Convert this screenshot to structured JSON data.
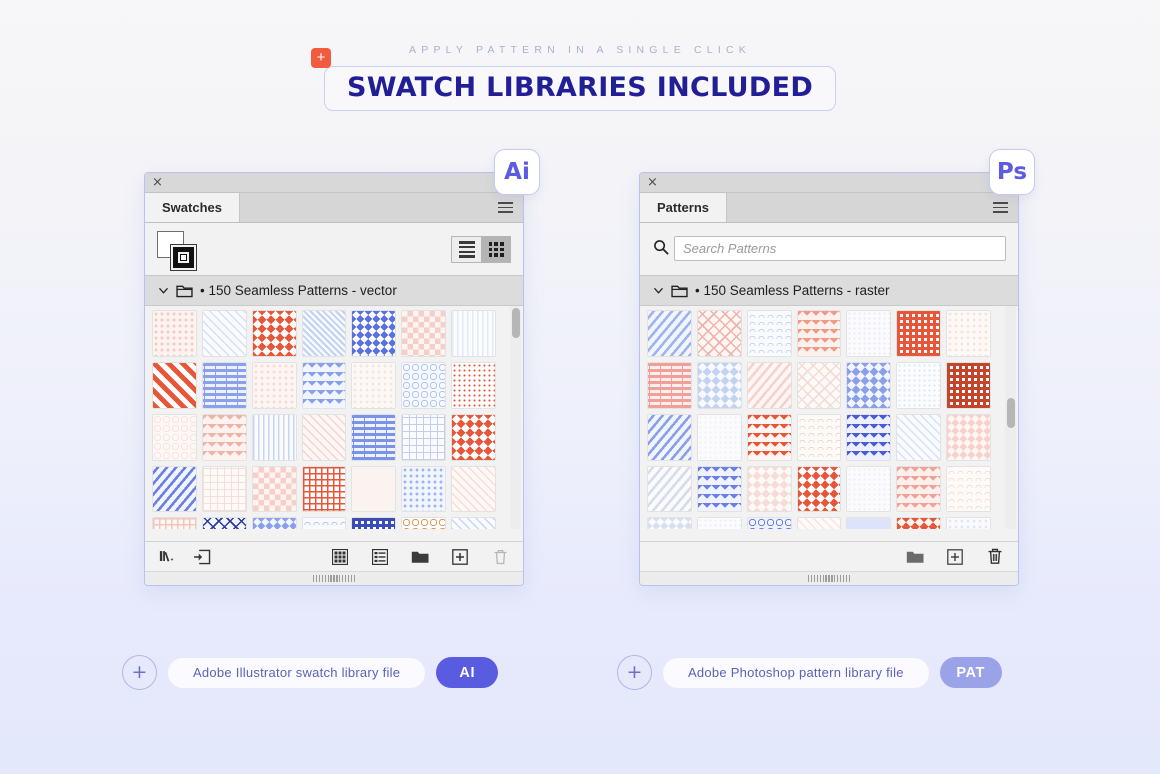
{
  "header": {
    "kicker": "APPLY PATTERN IN A SINGLE CLICK",
    "title": "SWATCH LIBRARIES INCLUDED",
    "plus_icon": "plus-icon",
    "accent_orange": "#F35B3F",
    "title_color": "#221E96"
  },
  "theme": {
    "bg_top": "#F7F7F9",
    "bg_bottom": "#E4E8FB",
    "purple": "#5A5CE0",
    "purple_light": "#9AA2E8",
    "panel_border": "#B9C2EE",
    "pattern_red": "#E8563A",
    "pattern_blue": "#5A6FE0",
    "pattern_pink": "#F3C9C2",
    "pattern_lightblue": "#B9C8F2"
  },
  "panels": [
    {
      "id": "illustrator",
      "app": "Ai",
      "close_label": "×",
      "tab_label": "Swatches",
      "menu_icon": "hamburger-menu-icon",
      "fill_stroke": {
        "fill_name": "fill-swatch",
        "stroke_name": "stroke-swatch"
      },
      "view_toggle": {
        "list_label": "list-view-icon",
        "grid_label": "grid-view-icon",
        "active": "grid"
      },
      "folder": {
        "chevron": "chevron-down-icon",
        "folder_icon": "folder-icon",
        "label": "• 150 Seamless Patterns - vector"
      },
      "footer_icons": [
        "swatch-libraries-menu-icon",
        "add-to-library-icon",
        "show-swatch-kinds-icon",
        "swatch-options-icon",
        "new-color-group-icon",
        "new-swatch-icon",
        "delete-swatch-icon"
      ]
    },
    {
      "id": "photoshop",
      "app": "Ps",
      "close_label": "×",
      "tab_label": "Patterns",
      "menu_icon": "hamburger-menu-icon",
      "search": {
        "icon": "search-icon",
        "placeholder": "Search Patterns",
        "value": ""
      },
      "folder": {
        "chevron": "chevron-down-icon",
        "folder_icon": "folder-icon",
        "label": "• 150 Seamless Patterns - raster"
      },
      "footer_icons": [
        "new-group-icon",
        "new-pattern-icon",
        "delete-pattern-icon"
      ]
    }
  ],
  "files": [
    {
      "id": "ai-file",
      "plus_icon": "plus-circle-icon",
      "label": "Adobe Illustrator swatch library file",
      "ext": "AI"
    },
    {
      "id": "ps-file",
      "plus_icon": "plus-circle-icon",
      "label": "Adobe Photoshop pattern library file",
      "ext": "PAT"
    }
  ],
  "swatch_grid": {
    "columns": 7,
    "illustrator_patterns": [
      {
        "t": "dotgrid",
        "c": "#F6C9C0",
        "bg": "#FDF3F0"
      },
      {
        "t": "diagline",
        "c": "#D9DFF4",
        "bg": "#FAFBFE"
      },
      {
        "t": "diamond",
        "c": "#E8563A",
        "bg": "#FFFFFF"
      },
      {
        "t": "diaghatch",
        "c": "#C3D2F2",
        "bg": "#F6F9FE"
      },
      {
        "t": "zigzag",
        "c": "#5A6FE0",
        "bg": "#FFFFFF"
      },
      {
        "t": "checker",
        "c": "#F3CFC8",
        "bg": "#FDF4F2"
      },
      {
        "t": "vline",
        "c": "#E3E9F8",
        "bg": "#FBFCFE"
      },
      {
        "t": "stripe",
        "c": "#E8563A",
        "bg": "#FFFFFF"
      },
      {
        "t": "brick",
        "c": "#8AA0EA",
        "bg": "#EDF1FD"
      },
      {
        "t": "dotgrid",
        "c": "#F7DAD3",
        "bg": "#FDF5F3"
      },
      {
        "t": "triangle",
        "c": "#8AA0EA",
        "bg": "#F1F5FE"
      },
      {
        "t": "dotgrid",
        "c": "#F3E6E0",
        "bg": "#FCF8F6"
      },
      {
        "t": "circles",
        "c": "#B4C6F0",
        "bg": "#F5F8FE"
      },
      {
        "t": "dotsm",
        "c": "#E8563A",
        "bg": "#FFFFFF"
      },
      {
        "t": "circles",
        "c": "#F7E4DE",
        "bg": "#FDF8F6"
      },
      {
        "t": "triangle",
        "c": "#F0B3AA",
        "bg": "#FDF2F0"
      },
      {
        "t": "vline",
        "c": "#C8D4F2",
        "bg": "#FAFBFE"
      },
      {
        "t": "diagline",
        "c": "#F6D4CD",
        "bg": "#FDF6F4"
      },
      {
        "t": "brick",
        "c": "#7A92E8",
        "bg": "#EEF2FD"
      },
      {
        "t": "grid",
        "c": "#C3CEEE",
        "bg": "#FAFBFE"
      },
      {
        "t": "diamond",
        "c": "#E8563A",
        "bg": "#FFFFFF"
      },
      {
        "t": "diagwave",
        "c": "#6B80E4",
        "bg": "#F2F5FE"
      },
      {
        "t": "grid",
        "c": "#F3DED8",
        "bg": "#FDF9F7"
      },
      {
        "t": "checker",
        "c": "#F5CFC8",
        "bg": "#FDF4F2"
      },
      {
        "t": "plus",
        "c": "#E8563A",
        "bg": "#FFFFFF"
      },
      {
        "t": "plain",
        "c": "#FBF3F0",
        "bg": "#FBF3F0"
      },
      {
        "t": "dotgrid",
        "c": "#9FB4EE",
        "bg": "#F1F5FE"
      },
      {
        "t": "diagline",
        "c": "#F6DCD5",
        "bg": "#FDF8F6"
      },
      {
        "t": "plus",
        "c": "#F0C6BD",
        "bg": "#FDF6F4"
      },
      {
        "t": "crosshatch",
        "c": "#2B3A9E",
        "bg": "#F4F6FD"
      },
      {
        "t": "zigzag",
        "c": "#8AA0EA",
        "bg": "#F3F6FE"
      },
      {
        "t": "wave",
        "c": "#B8C7F0",
        "bg": "#F8FAFE"
      },
      {
        "t": "blockdot",
        "c": "#3A4CB8",
        "bg": "#FFFFFF"
      },
      {
        "t": "circles",
        "c": "#E8975A",
        "bg": "#FFFFFF"
      },
      {
        "t": "diagline",
        "c": "#C8D4F2",
        "bg": "#FAFBFE"
      }
    ],
    "photoshop_patterns": [
      {
        "t": "diagwave",
        "c": "#9FB4EE",
        "bg": "#F2F5FE"
      },
      {
        "t": "crosshatch",
        "c": "#F0B3AA",
        "bg": "#FDF6F4"
      },
      {
        "t": "wave",
        "c": "#C8D6F3",
        "bg": "#F9FBFE"
      },
      {
        "t": "triangle",
        "c": "#F09A8A",
        "bg": "#FDF1EE"
      },
      {
        "t": "dotsm",
        "c": "#E8E8F2",
        "bg": "#FBFBFE"
      },
      {
        "t": "blockdot",
        "c": "#E8563A",
        "bg": "#FFFFFF"
      },
      {
        "t": "dotgrid",
        "c": "#F8E2DC",
        "bg": "#FDF9F7"
      },
      {
        "t": "brick",
        "c": "#F0A098",
        "bg": "#FCEEEC"
      },
      {
        "t": "diamond",
        "c": "#C4D2F2",
        "bg": "#F7F9FE"
      },
      {
        "t": "diagwave",
        "c": "#F6D2CA",
        "bg": "#FDF6F4"
      },
      {
        "t": "crosshatch",
        "c": "#F2DCD6",
        "bg": "#FCF9F7"
      },
      {
        "t": "diamond",
        "c": "#8AA0EA",
        "bg": "#F2F5FE"
      },
      {
        "t": "dotsm",
        "c": "#DDE5F6",
        "bg": "#FAFCFE"
      },
      {
        "t": "blockdot",
        "c": "#C4452A",
        "bg": "#FFFFFF"
      },
      {
        "t": "diagwave",
        "c": "#8AA0EA",
        "bg": "#F2F5FE"
      },
      {
        "t": "dotsm",
        "c": "#EFEFF6",
        "bg": "#FBFBFE"
      },
      {
        "t": "triangle",
        "c": "#E8563A",
        "bg": "#FFF5F2"
      },
      {
        "t": "wave",
        "c": "#EFD8D2",
        "bg": "#FDFAF8"
      },
      {
        "t": "triangle",
        "c": "#4A5DD8",
        "bg": "#EEF1FD"
      },
      {
        "t": "diagline",
        "c": "#D8E0F6",
        "bg": "#F9FBFE"
      },
      {
        "t": "zigzag",
        "c": "#F6D2CA",
        "bg": "#FDF6F4"
      },
      {
        "t": "diagwave",
        "c": "#D8DCEA",
        "bg": "#FAFBFD"
      },
      {
        "t": "triangle",
        "c": "#6B80E4",
        "bg": "#F0F3FE"
      },
      {
        "t": "diamond",
        "c": "#F7DCD6",
        "bg": "#FDF9F7"
      },
      {
        "t": "diamond",
        "c": "#E8563A",
        "bg": "#FFFFFF"
      },
      {
        "t": "dotsm",
        "c": "#EDEDF5",
        "bg": "#FBFBFE"
      },
      {
        "t": "triangle",
        "c": "#F0A298",
        "bg": "#FCEFEC"
      },
      {
        "t": "wave",
        "c": "#F4DED8",
        "bg": "#FDFAF8"
      },
      {
        "t": "zigzag",
        "c": "#D8DFF0",
        "bg": "#FAFBFE"
      },
      {
        "t": "dotsm",
        "c": "#E8ECF8",
        "bg": "#FBFCFE"
      },
      {
        "t": "circles",
        "c": "#6B80E4",
        "bg": "#EFF2FE"
      },
      {
        "t": "diagline",
        "c": "#F8E4DE",
        "bg": "#FDFAF9"
      },
      {
        "t": "plain",
        "c": "#DDE3FA",
        "bg": "#DDE3FA"
      },
      {
        "t": "diamond",
        "c": "#E8563A",
        "bg": "#FFF6F3"
      },
      {
        "t": "dotgrid",
        "c": "#E2E6F2",
        "bg": "#FAFBFE"
      }
    ]
  }
}
